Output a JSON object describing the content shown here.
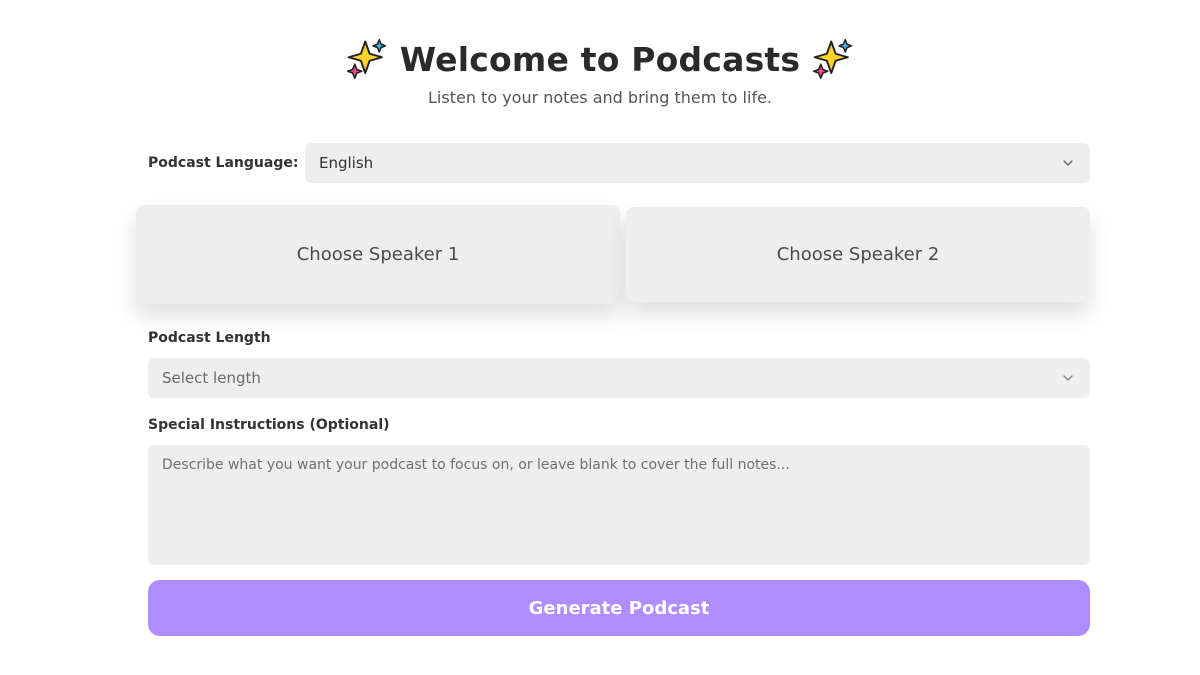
{
  "header": {
    "title": "Welcome to Podcasts",
    "subtitle": "Listen to your notes and bring them to life.",
    "icon": "sparkles-icon"
  },
  "language": {
    "label": "Podcast Language:",
    "value": "English"
  },
  "speakers": {
    "speaker1_label": "Choose Speaker 1",
    "speaker2_label": "Choose Speaker 2"
  },
  "length": {
    "label": "Podcast Length",
    "placeholder": "Select length"
  },
  "instructions": {
    "label": "Special Instructions (Optional)",
    "placeholder": "Describe what you want your podcast to focus on, or leave blank to cover the full notes..."
  },
  "generate": {
    "label": "Generate Podcast"
  },
  "colors": {
    "accent": "#b08cff",
    "field_bg": "#efeeee"
  }
}
